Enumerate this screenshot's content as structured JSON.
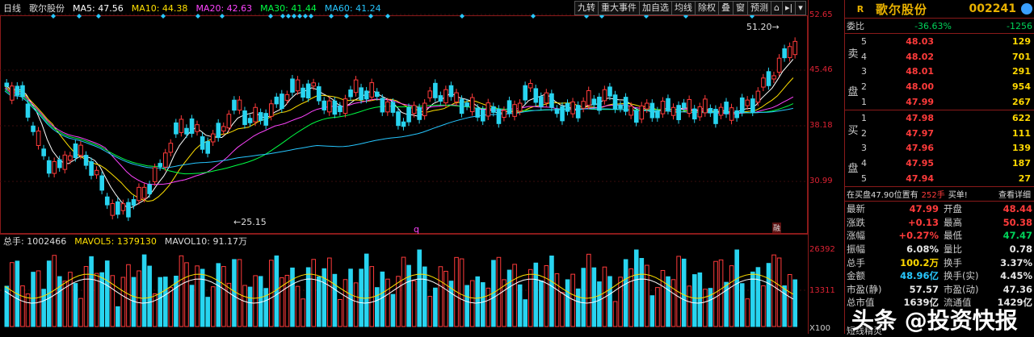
{
  "chart": {
    "period": "日线",
    "stock_name": "歌尔股份",
    "ma": [
      {
        "label": "MA5: 47.56",
        "color": "#ffffff"
      },
      {
        "label": "MA10: 44.38",
        "color": "#ffe000"
      },
      {
        "label": "MA20: 42.63",
        "color": "#ff44ff"
      },
      {
        "label": "MA30: 41.44",
        "color": "#00ff44"
      },
      {
        "label": "MA60: 41.24",
        "color": "#26c6ff"
      }
    ],
    "price_axis": [
      "52.65",
      "45.46",
      "38.18",
      "30.99"
    ],
    "high_marker": "51.20",
    "low_marker": "25.15",
    "vol_legend": {
      "total": "总手: 1002466",
      "mavol5": "MAVOL5: 1379130",
      "mavol10": "MAVOL10: 91.17万"
    },
    "vol_axis": [
      "26392",
      "13311",
      "X100"
    ],
    "marker_q": "q",
    "marker_rong": "融",
    "toolbar": [
      "九转",
      "重大事件",
      "加自选",
      "均线",
      "除权",
      "叠",
      "窗",
      "预测"
    ]
  },
  "stock": {
    "badge": "R",
    "name": "歌尔股份",
    "code": "002241"
  },
  "weibi": {
    "label": "委比",
    "value": "-36.63%",
    "diff": "-1256"
  },
  "sell_side_label": [
    "卖",
    "盘"
  ],
  "buy_side_label": [
    "买",
    "盘"
  ],
  "sell": [
    {
      "lvl": "5",
      "price": "48.03",
      "vol": "129"
    },
    {
      "lvl": "4",
      "price": "48.02",
      "vol": "701"
    },
    {
      "lvl": "3",
      "price": "48.01",
      "vol": "291"
    },
    {
      "lvl": "2",
      "price": "48.00",
      "vol": "954"
    },
    {
      "lvl": "1",
      "price": "47.99",
      "vol": "267"
    }
  ],
  "buy": [
    {
      "lvl": "1",
      "price": "47.98",
      "vol": "622"
    },
    {
      "lvl": "2",
      "price": "47.97",
      "vol": "111"
    },
    {
      "lvl": "3",
      "price": "47.96",
      "vol": "139"
    },
    {
      "lvl": "4",
      "price": "47.95",
      "vol": "187"
    },
    {
      "lvl": "5",
      "price": "47.94",
      "vol": "27"
    }
  ],
  "detail_bar": {
    "text": "在买盘47.90位置有",
    "amount": "252手",
    "action": "买单!",
    "link": "查看详细"
  },
  "quote": [
    {
      "l1": "最新",
      "v1": "47.99",
      "c1": "red",
      "l2": "开盘",
      "v2": "48.44",
      "c2": "red"
    },
    {
      "l1": "涨跌",
      "v1": "+0.13",
      "c1": "red",
      "l2": "最高",
      "v2": "50.38",
      "c2": "red"
    },
    {
      "l1": "涨幅",
      "v1": "+0.27%",
      "c1": "red",
      "l2": "最低",
      "v2": "47.47",
      "c2": "green"
    },
    {
      "l1": "振幅",
      "v1": "6.08%",
      "c1": "white",
      "l2": "量比",
      "v2": "0.78",
      "c2": "white"
    },
    {
      "l1": "总手",
      "v1": "100.2万",
      "c1": "yellow",
      "l2": "换手",
      "v2": "3.37%",
      "c2": "white"
    },
    {
      "l1": "金额",
      "v1": "48.96亿",
      "c1": "cyan",
      "l2": "换手(实)",
      "v2": "4.45%",
      "c2": "white"
    },
    {
      "l1": "市盈(静)",
      "v1": "57.57",
      "c1": "white",
      "l2": "市盈(动)",
      "v2": "47.36",
      "c2": "white"
    },
    {
      "l1": "总市值",
      "v1": "1639亿",
      "c1": "white",
      "l2": "流通值",
      "v2": "1429亿",
      "c2": "white"
    }
  ],
  "bottom_tab": "短线精灵",
  "watermark": "头条 @投资快报"
}
